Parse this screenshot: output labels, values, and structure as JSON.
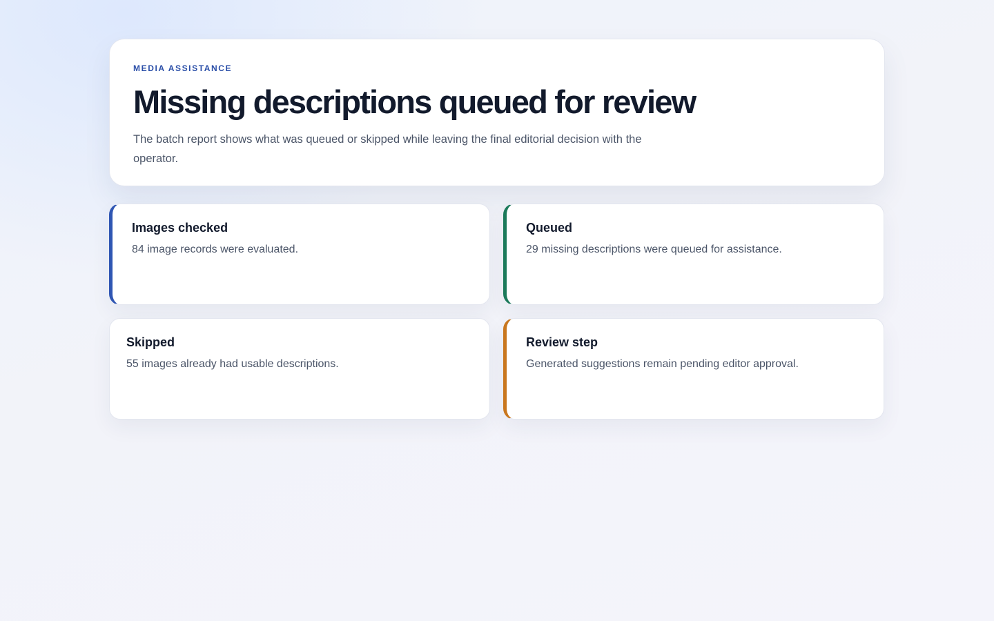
{
  "header": {
    "eyebrow": "MEDIA ASSISTANCE",
    "title": "Missing descriptions queued for review",
    "subtitle": "The batch report shows what was queued or skipped while leaving the final editorial decision with the operator."
  },
  "cards": [
    {
      "title": "Images checked",
      "body": "84 image records were evaluated.",
      "accent": "#2f56b3"
    },
    {
      "title": "Queued",
      "body": "29 missing descriptions were queued for assistance.",
      "accent": "#1b7a5a"
    },
    {
      "title": "Skipped",
      "body": "55 images already had usable descriptions.",
      "accent": null
    },
    {
      "title": "Review step",
      "body": "Generated suggestions remain pending editor approval.",
      "accent": "#c9771e"
    }
  ]
}
